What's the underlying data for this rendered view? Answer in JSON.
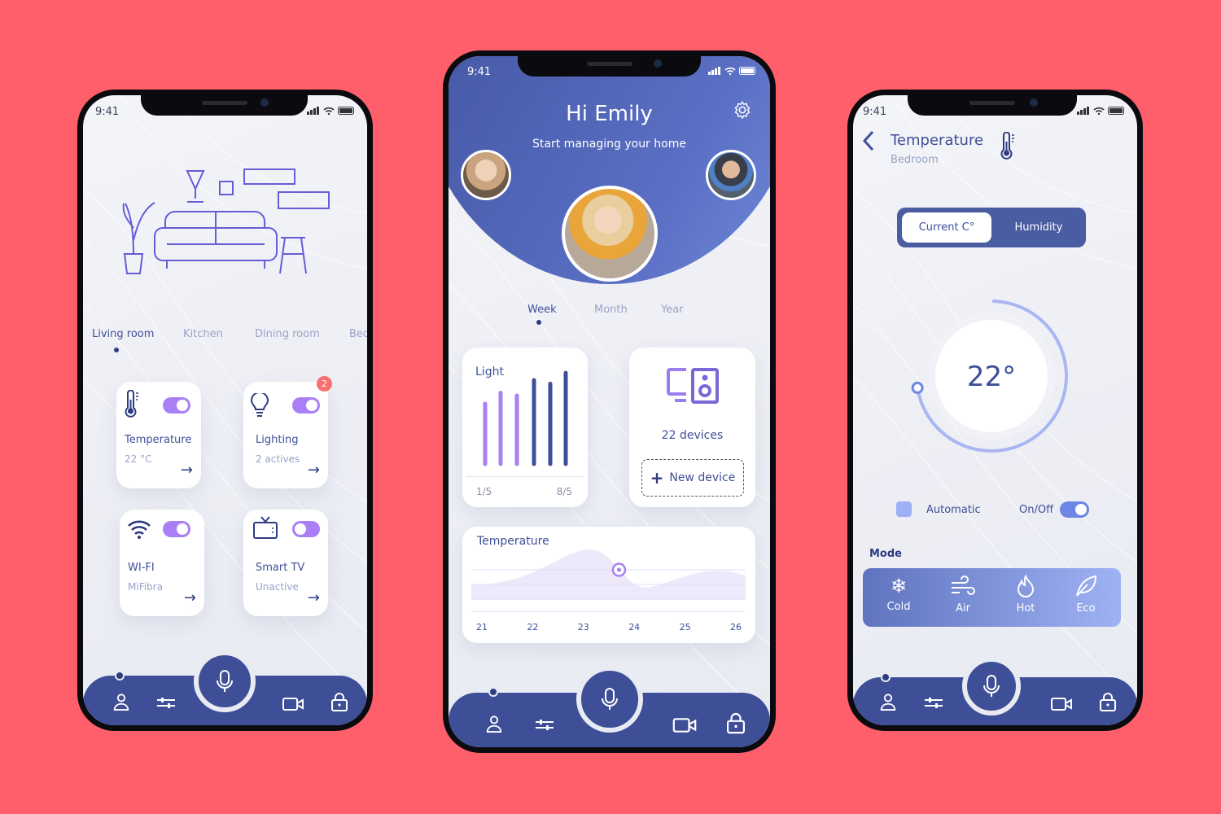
{
  "colors": {
    "background": "#ff5f6b",
    "navy": "#3e4f98",
    "purple": "#a97ff5",
    "accent_blue": "#6d86e6",
    "badge": "#f86f6f"
  },
  "status_time": "9:41",
  "home": {
    "rooms": [
      "Living room",
      "Kitchen",
      "Dining room",
      "Bed"
    ],
    "active_room": "Living room",
    "devices": [
      {
        "name": "Temperature",
        "status": "22 °C",
        "icon": "thermometer-icon",
        "on": true
      },
      {
        "name": "Lighting",
        "status": "2 actives",
        "icon": "lightbulb-icon",
        "on": true,
        "badge": "2"
      },
      {
        "name": "WI-FI",
        "status": "MiFibra",
        "icon": "wifi-icon",
        "on": true
      },
      {
        "name": "Smart TV",
        "status": "Unactive",
        "icon": "tv-icon",
        "on": false
      }
    ],
    "arrow": "→"
  },
  "dashboard": {
    "greeting": "Hi Emily",
    "subtitle": "Start managing your home",
    "periods": [
      "Week",
      "Month",
      "Year"
    ],
    "active_period": "Week",
    "light_card": {
      "title": "Light",
      "start_label": "1/5",
      "end_label": "8/5",
      "bars": [
        0.66,
        0.78,
        0.75,
        0.92,
        0.88,
        1.0
      ]
    },
    "devices_card": {
      "count": "22 devices",
      "button_icon": "+",
      "button": "New device"
    },
    "temperature_card": {
      "title": "Temperature",
      "x_labels": [
        "21",
        "22",
        "23",
        "24",
        "25",
        "26"
      ],
      "selected_x": 23.7
    }
  },
  "thermostat": {
    "title": "Temperature",
    "room": "Bedroom",
    "segments": [
      "Current C°",
      "Humidity"
    ],
    "active_segment": "Current C°",
    "value": "22°",
    "dial_level": 0.72,
    "automatic_label": "Automatic",
    "onoff_label": "On/Off",
    "on": true,
    "mode_label": "Mode",
    "modes": [
      "Cold",
      "Air",
      "Hot",
      "Eco"
    ]
  }
}
